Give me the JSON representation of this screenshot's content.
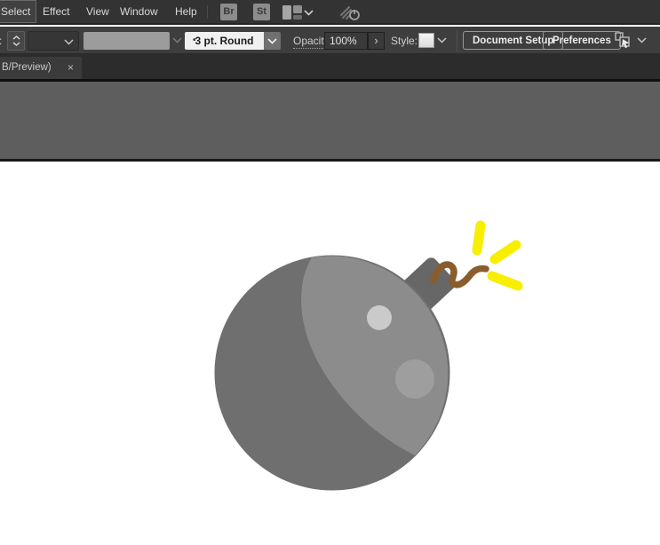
{
  "window": {
    "menu_bar": {
      "items": [
        "Select",
        "Effect",
        "View",
        "Window",
        "Help"
      ],
      "bridge_icon_label": "Br",
      "stock_icon_label": "St"
    },
    "control_bar": {
      "stroke_label_fragment": ":",
      "brush_definition": {
        "dot": "•",
        "value": "3 pt. Round"
      },
      "opacity": {
        "label": "Opacity:",
        "value": "100%",
        "expand_glyph": "›"
      },
      "style_label": "Style:",
      "document_setup_label": "Document Setup",
      "preferences_label": "Preferences"
    },
    "tab_bar": {
      "document_tab": {
        "title": "B/Preview)",
        "close_glyph": "×"
      }
    }
  },
  "canvas": {
    "artwork": "bomb-illustration",
    "colors": {
      "body": "#6f6f6f",
      "body_light": "#8c8c8c",
      "highlight_small": "#cacaca",
      "highlight_large": "#9e9e9e",
      "cap": "#676767",
      "fuse": "#8a5c2e",
      "spark": "#f7ee00",
      "pasteboard": "#5e5e5e",
      "artboard": "#ffffff"
    }
  }
}
